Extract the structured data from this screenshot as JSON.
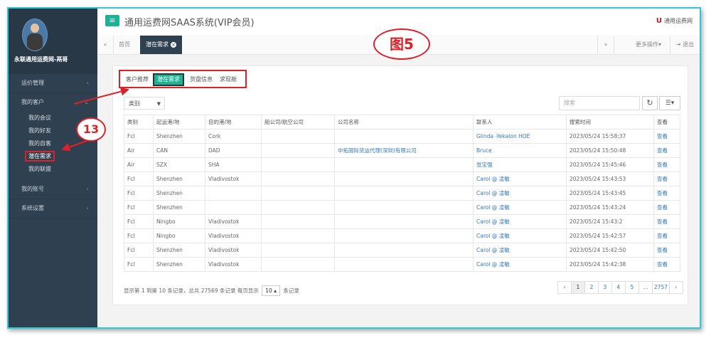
{
  "app": {
    "title": "通用运费网SAAS系统(VIP会员)",
    "brand": "通用运费网",
    "brand_mark": "U",
    "user_name": "永联通用运费网-鬲哥"
  },
  "sidebar": {
    "items": [
      {
        "label": "运价管理",
        "arrow": "‹"
      },
      {
        "label": "我的客户",
        "arrow": "⌄"
      },
      {
        "label": "我的账号",
        "arrow": "‹"
      },
      {
        "label": "系统设置",
        "arrow": "‹"
      }
    ],
    "sub_items": [
      "我的会议",
      "我的好友",
      "我的自客",
      "潜在需求",
      "我的联盟"
    ]
  },
  "tabs": {
    "home": "首页",
    "active": "潜在需求",
    "more": "更多操作▾",
    "logout": "退出"
  },
  "figure_label": "图5",
  "annotation_number": "13",
  "subtabs": [
    "客户推荐",
    "潜在需求",
    "货盘信息",
    "求现舱"
  ],
  "filter": {
    "label": "类别"
  },
  "search": {
    "placeholder": "搜索"
  },
  "table": {
    "headers": [
      "类别",
      "起运港/地",
      "目的港/地",
      "船公司/航空公司",
      "公司名称",
      "联系人",
      "搜索时间",
      "查看"
    ],
    "rows": [
      [
        "Fcl",
        "Shenzhen",
        "Cork",
        "",
        "",
        "Glinda -Yekalon HOE",
        "2023/05/24 15:58:37",
        "查看"
      ],
      [
        "Air",
        "CAN",
        "DAD",
        "",
        "中拓国际货运代理(深圳)有限公司",
        "Bruce",
        "2023/05/24 15:50:48",
        "查看"
      ],
      [
        "Air",
        "SZX",
        "SHA",
        "",
        "",
        "张宝强",
        "2023/05/24 15:45:46",
        "查看"
      ],
      [
        "Fcl",
        "Shenzhen",
        "Vladivostok",
        "",
        "",
        "Carol @ 凌敏",
        "2023/05/24 15:43:53",
        "查看"
      ],
      [
        "Fcl",
        "Shenzhen",
        "",
        "",
        "",
        "Carol @ 凌敏",
        "2023/05/24 15:43:45",
        "查看"
      ],
      [
        "Fcl",
        "Shenzhen",
        "",
        "",
        "",
        "Carol @ 凌敏",
        "2023/05/24 15:43:24",
        "查看"
      ],
      [
        "Fcl",
        "Ningbo",
        "Vladivostok",
        "",
        "",
        "Carol @ 凌敏",
        "2023/05/24 15:43:2",
        "查看"
      ],
      [
        "Fcl",
        "Ningbo",
        "Vladivostok",
        "",
        "",
        "Carol @ 凌敏",
        "2023/05/24 15:42:57",
        "查看"
      ],
      [
        "Fcl",
        "Shenzhen",
        "Vladivostok",
        "",
        "",
        "Carol @ 凌敏",
        "2023/05/24 15:42:50",
        "查看"
      ],
      [
        "Fcl",
        "Shenzhen",
        "Vladivostok",
        "",
        "",
        "Carol @ 凌敏",
        "2023/05/24 15:42:38",
        "查看"
      ]
    ]
  },
  "footer": {
    "summary": "显示第 1 到第 10 条记录，总共 27569 条记录 每页显示",
    "page_size": "10 ▴",
    "suffix": "条记录"
  },
  "pager": [
    "‹",
    "1",
    "2",
    "3",
    "4",
    "5",
    "...",
    "2757",
    "›"
  ],
  "colors": {
    "accent": "#1ab394",
    "sidebar": "#2f4050",
    "annotation": "#d9222a"
  }
}
